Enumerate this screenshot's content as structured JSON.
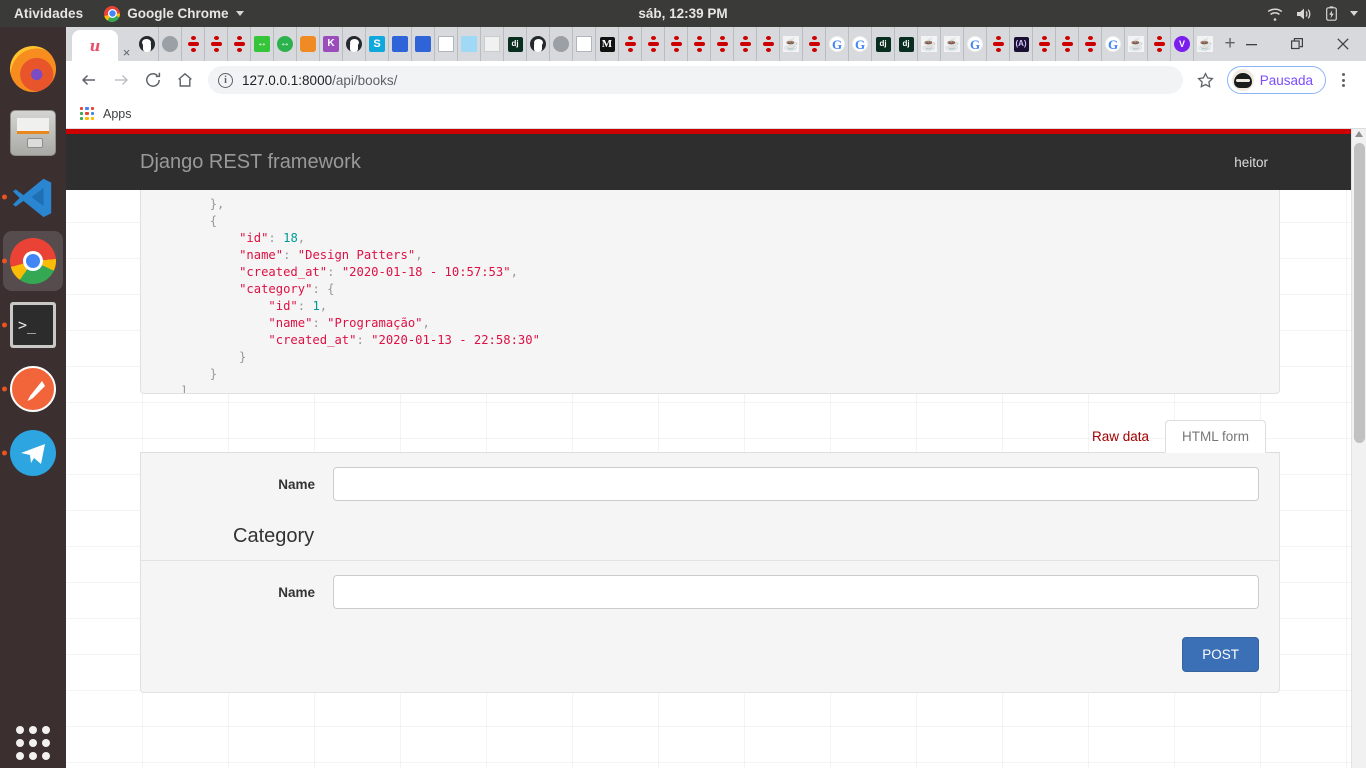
{
  "topbar": {
    "activities": "Atividades",
    "app_name": "Google Chrome",
    "clock": "sáb, 12:39 PM",
    "icons": [
      "wifi-icon",
      "volume-icon",
      "battery-icon",
      "caret-down-icon"
    ]
  },
  "dock": {
    "items": [
      {
        "name": "firefox",
        "running": false,
        "active": false
      },
      {
        "name": "files",
        "running": false,
        "active": false
      },
      {
        "name": "vscode",
        "running": true,
        "active": false
      },
      {
        "name": "google-chrome",
        "running": true,
        "active": true
      },
      {
        "name": "terminal",
        "running": true,
        "active": false
      },
      {
        "name": "postman",
        "running": true,
        "active": false
      },
      {
        "name": "telegram",
        "running": true,
        "active": false
      }
    ],
    "show_apps_label": "show-applications"
  },
  "browser": {
    "active_tab": {
      "favicon": "u",
      "close_label": "×"
    },
    "new_tab_label": "+",
    "window_controls": {
      "minimize": "—",
      "maximize": "❐",
      "close": "✕"
    },
    "toolbar": {
      "back": "←",
      "forward": "→",
      "reload": "⟳",
      "home": "⌂",
      "url_host": "127.0.0.1:8000",
      "url_path": "/api/books/",
      "url_full": "127.0.0.1:8000/api/books/",
      "bookmark_star": "☆",
      "profile_name": "Pausada",
      "menu": "kebab-menu-icon"
    },
    "bookmarks": [
      {
        "label": "Apps",
        "icon": "apps-grid-icon"
      }
    ],
    "pinned_tabs": [
      "github",
      "globe",
      "rails",
      "rails",
      "rails",
      "bracket-green",
      "circle-green",
      "box-orange",
      "purple-k",
      "github",
      "s-blue",
      "flag-blue",
      "flag-blue",
      "sheet",
      "cloud",
      "cube",
      "django",
      "github",
      "globe",
      "sheet",
      "medium",
      "rails",
      "rails",
      "rails",
      "rails",
      "rails",
      "rails",
      "rails",
      "java",
      "rails",
      "google",
      "google",
      "django",
      "django",
      "java",
      "java",
      "google",
      "rails",
      "a-dark",
      "rails",
      "rails",
      "rails",
      "google",
      "java",
      "rails",
      "v-purple",
      "java"
    ]
  },
  "page": {
    "brand": "Django REST framework",
    "user": "heitor",
    "raw_json": "        },\n        {\n            \"id\": 18,\n            \"name\": \"Design Patters\",\n            \"created_at\": \"2020-01-18 - 10:57:53\",\n            \"category\": {\n                \"id\": 1,\n                \"name\": \"Programação\",\n                \"created_at\": \"2020-01-13 - 22:58:30\"\n            }\n        }\n    ]",
    "json_preview": {
      "id": 18,
      "name": "Design Patters",
      "created_at": "2020-01-18 - 10:57:53",
      "category": {
        "id": 1,
        "name": "Programação",
        "created_at": "2020-01-13 - 22:58:30"
      }
    },
    "tabs": [
      {
        "label": "Raw data",
        "active": false
      },
      {
        "label": "HTML form",
        "active": true
      }
    ],
    "form": {
      "name_label": "Name",
      "name_value": "",
      "name_placeholder": "",
      "fieldset_title": "Category",
      "category_name_label": "Name",
      "category_name_value": "",
      "category_name_placeholder": "",
      "submit_label": "POST"
    }
  },
  "colors": {
    "drf_red": "#cc0000",
    "drf_nav": "#2e2e2e",
    "post_button": "#3b6fb6",
    "link_red": "#a30000",
    "ubuntu_orange": "#e95420"
  }
}
